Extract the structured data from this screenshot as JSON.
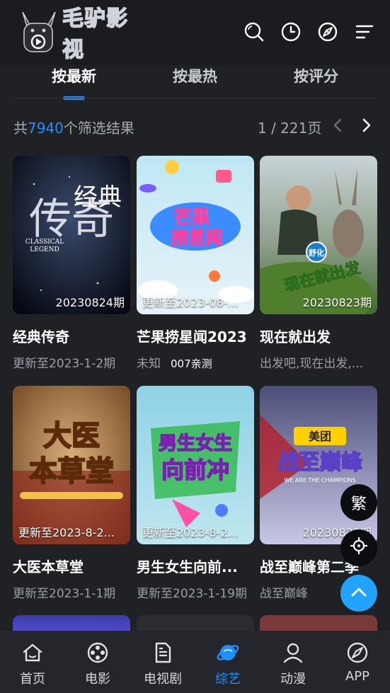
{
  "app": {
    "logo_text": "毛驴影视"
  },
  "header": {
    "icons": [
      "search-icon",
      "history-icon",
      "compass-icon",
      "menu-icon"
    ]
  },
  "tabs": [
    {
      "label": "按最新",
      "active": true
    },
    {
      "label": "按最热",
      "active": false
    },
    {
      "label": "按评分",
      "active": false
    }
  ],
  "results": {
    "prefix": "共",
    "count": "7940",
    "suffix": "个筛选结果",
    "page_text": "1 / 221页"
  },
  "cards": [
    {
      "title": "经典传奇",
      "subtitle": "更新至2023-1-2期",
      "badge": "20230824期",
      "badge_align": "right"
    },
    {
      "title": "芒果捞星闻2023",
      "subtitle": "未知",
      "subtitle_extra": "007亲测",
      "badge": "更新至2023-08-...",
      "badge_align": "left"
    },
    {
      "title": "现在就出发",
      "subtitle": "出发吧,现在出发,...",
      "badge": "20230823期",
      "badge_align": "right"
    },
    {
      "title": "大医本草堂",
      "subtitle": "更新至2023-1-1期",
      "badge": "更新至2023-8-2...",
      "badge_align": "left"
    },
    {
      "title": "男生女生向前...",
      "subtitle": "更新至2023-1-19期",
      "badge": "更新至2023-8-2...",
      "badge_align": "left"
    },
    {
      "title": "战至巅峰第二季",
      "subtitle": "战至巅峰",
      "badge": "20230823期",
      "badge_align": "right"
    }
  ],
  "floating": {
    "traditional_label": "繁"
  },
  "bottom_nav": [
    {
      "label": "首页",
      "icon": "home-icon",
      "active": false
    },
    {
      "label": "电影",
      "icon": "film-reel-icon",
      "active": false
    },
    {
      "label": "电视剧",
      "icon": "document-icon",
      "active": false
    },
    {
      "label": "综艺",
      "icon": "planet-icon",
      "active": true
    },
    {
      "label": "动漫",
      "icon": "user-icon",
      "active": false
    },
    {
      "label": "APP",
      "icon": "compass-icon",
      "active": false
    }
  ],
  "colors": {
    "accent": "#1e90ff",
    "background": "#1f2125",
    "fab_blue": "#21a3ff"
  }
}
